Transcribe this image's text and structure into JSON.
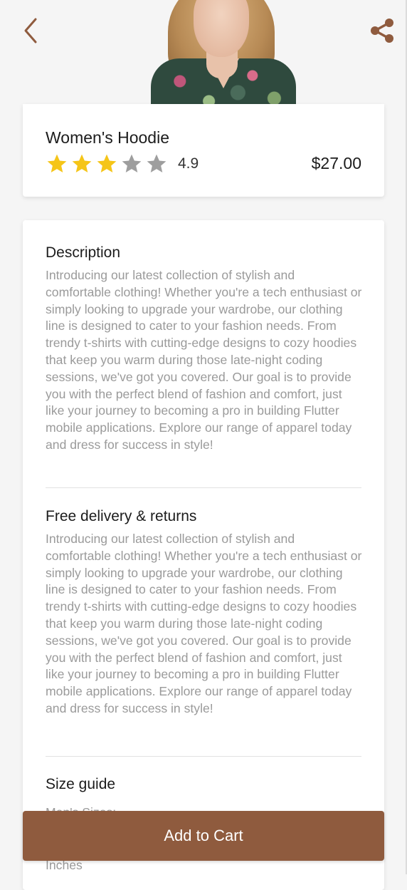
{
  "colors": {
    "accent": "#8f5b3e",
    "star_filled": "#f5c518",
    "star_empty": "#9e9e9e",
    "text_muted": "#9a9a9a"
  },
  "header": {
    "back_icon": "chevron-left-icon",
    "share_icon": "share-icon"
  },
  "product": {
    "name": "Women's Hoodie",
    "rating_value": "4.9",
    "stars_filled": 3,
    "stars_total": 5,
    "price": "$27.00"
  },
  "sections": {
    "description": {
      "title": "Description",
      "body": "Introducing our latest collection of stylish and comfortable clothing! Whether you're a tech enthusiast or simply looking to upgrade your wardrobe, our clothing line is designed to cater to your fashion needs. From trendy t-shirts with cutting-edge designs to cozy hoodies that keep you warm during those late-night coding sessions, we've got you covered. Our goal is to provide you with the perfect blend of fashion and comfort, just like your journey to becoming a pro in building Flutter mobile applications. Explore our range of apparel today and dress for success in style!"
    },
    "delivery": {
      "title": "Free delivery & returns",
      "body": "Introducing our latest collection of stylish and comfortable clothing! Whether you're a tech enthusiast or simply looking to upgrade your wardrobe, our clothing line is designed to cater to your fashion needs. From trendy t-shirts with cutting-edge designs to cozy hoodies that keep you warm during those late-night coding sessions, we've got you covered. Our goal is to provide you with the perfect blend of fashion and comfort, just like your journey to becoming a pro in building Flutter mobile applications. Explore our range of apparel today and dress for success in style!"
    },
    "size_guide": {
      "title": "Size guide",
      "subtitle": "Men's Sizes:",
      "units": "Inches"
    }
  },
  "cta": {
    "add_to_cart": "Add to Cart"
  }
}
